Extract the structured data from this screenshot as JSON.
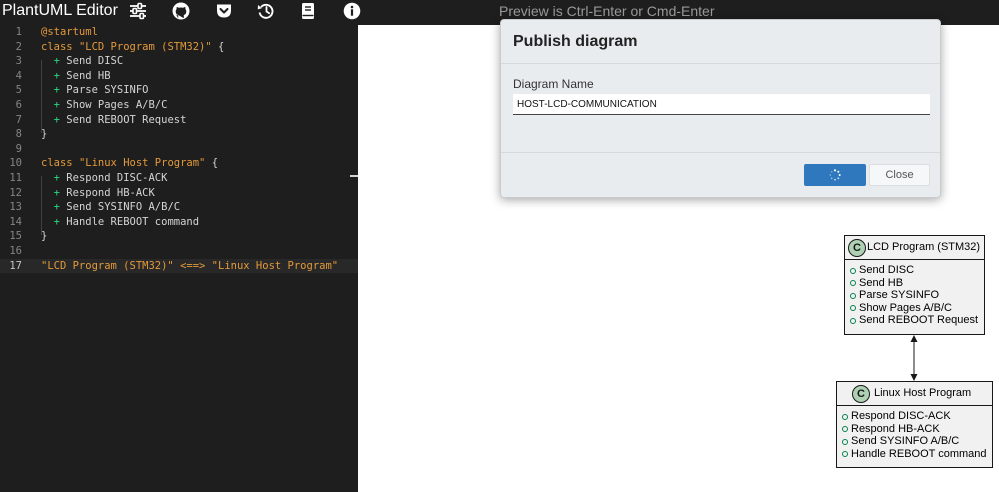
{
  "app": {
    "title": "PlantUML Editor",
    "preview_hint": "Preview is Ctrl-Enter or Cmd-Enter"
  },
  "toolbar": [
    {
      "name": "settings-sliders-icon",
      "label": "Settings"
    },
    {
      "name": "github-icon",
      "label": "GitHub"
    },
    {
      "name": "pocket-save-icon",
      "label": "Save"
    },
    {
      "name": "history-icon",
      "label": "History"
    },
    {
      "name": "book-icon",
      "label": "Docs"
    },
    {
      "name": "info-icon",
      "label": "Info"
    }
  ],
  "editor": {
    "active_line": 17,
    "lines": [
      {
        "n": "1",
        "tokens": [
          {
            "t": "@startuml",
            "c": "kw"
          }
        ]
      },
      {
        "n": "2",
        "tokens": [
          {
            "t": "class ",
            "c": "kw"
          },
          {
            "t": "\"LCD Program (STM32)\"",
            "c": "str"
          },
          {
            "t": " {",
            "c": "txt"
          }
        ]
      },
      {
        "n": "3",
        "tokens": [
          {
            "t": "  + ",
            "c": "plus"
          },
          {
            "t": "Send DISC",
            "c": "txt"
          }
        ]
      },
      {
        "n": "4",
        "tokens": [
          {
            "t": "  + ",
            "c": "plus"
          },
          {
            "t": "Send HB",
            "c": "txt"
          }
        ]
      },
      {
        "n": "5",
        "tokens": [
          {
            "t": "  + ",
            "c": "plus"
          },
          {
            "t": "Parse SYSINFO",
            "c": "txt"
          }
        ]
      },
      {
        "n": "6",
        "tokens": [
          {
            "t": "  + ",
            "c": "plus"
          },
          {
            "t": "Show Pages A/B/C",
            "c": "txt"
          }
        ]
      },
      {
        "n": "7",
        "tokens": [
          {
            "t": "  + ",
            "c": "plus"
          },
          {
            "t": "Send REBOOT Request",
            "c": "txt"
          }
        ]
      },
      {
        "n": "8",
        "tokens": [
          {
            "t": "}",
            "c": "txt"
          }
        ]
      },
      {
        "n": "9",
        "tokens": []
      },
      {
        "n": "10",
        "tokens": [
          {
            "t": "class ",
            "c": "kw"
          },
          {
            "t": "\"Linux Host Program\"",
            "c": "str"
          },
          {
            "t": " {",
            "c": "txt"
          }
        ]
      },
      {
        "n": "11",
        "tokens": [
          {
            "t": "  + ",
            "c": "plus"
          },
          {
            "t": "Respond DISC-ACK",
            "c": "txt"
          }
        ]
      },
      {
        "n": "12",
        "tokens": [
          {
            "t": "  + ",
            "c": "plus"
          },
          {
            "t": "Respond HB-ACK",
            "c": "txt"
          }
        ]
      },
      {
        "n": "13",
        "tokens": [
          {
            "t": "  + ",
            "c": "plus"
          },
          {
            "t": "Send SYSINFO A/B/C",
            "c": "txt"
          }
        ]
      },
      {
        "n": "14",
        "tokens": [
          {
            "t": "  + ",
            "c": "plus"
          },
          {
            "t": "Handle REBOOT command",
            "c": "txt"
          }
        ]
      },
      {
        "n": "15",
        "tokens": [
          {
            "t": "}",
            "c": "txt"
          }
        ]
      },
      {
        "n": "16",
        "tokens": []
      },
      {
        "n": "17",
        "tokens": [
          {
            "t": "\"LCD Program (STM32)\" <==> \"Linux Host Program\"",
            "c": "str"
          }
        ]
      }
    ]
  },
  "dialog": {
    "title": "Publish diagram",
    "field_label": "Diagram Name",
    "field_value": "HOST-LCD-COMMUNICATION",
    "primary_state": "loading",
    "close_label": "Close"
  },
  "diagram": {
    "class_a": {
      "badge": "C",
      "name": "LCD Program (STM32)",
      "members": [
        "Send DISC",
        "Send HB",
        "Parse SYSINFO",
        "Show Pages A/B/C",
        "Send REBOOT Request"
      ]
    },
    "class_b": {
      "badge": "C",
      "name": "Linux Host Program",
      "members": [
        "Respond DISC-ACK",
        "Respond HB-ACK",
        "Send SYSINFO A/B/C",
        "Handle REBOOT command"
      ]
    }
  },
  "colors": {
    "editor_bg": "#1e1e1e",
    "keyword": "#e39a3a",
    "plus": "#2bd87a",
    "primary_button": "#2f78bd",
    "class_badge": "#add1b2"
  }
}
